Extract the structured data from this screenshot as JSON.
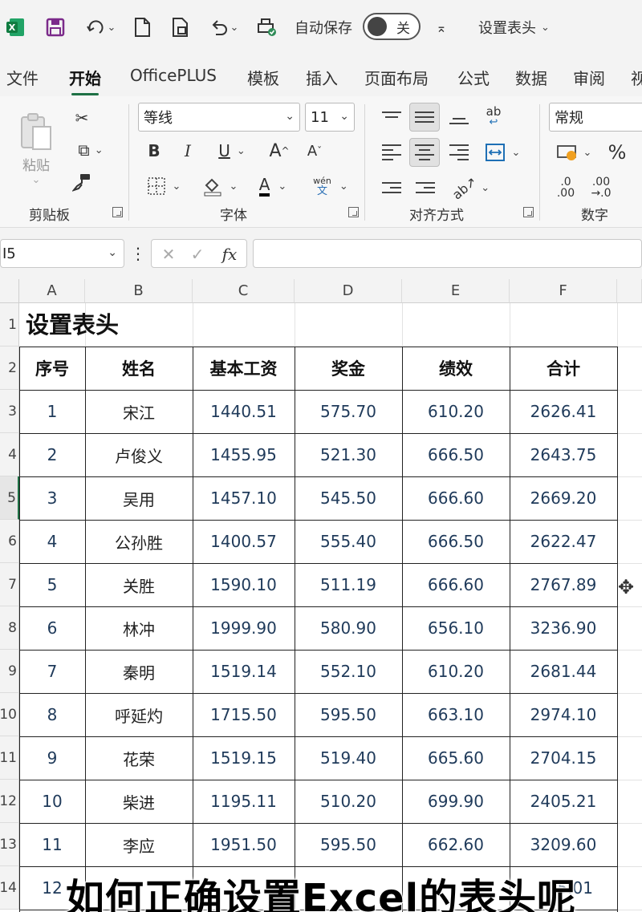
{
  "titlebar": {
    "autosave_label": "自动保存",
    "autosave_state": "关",
    "doc_title": "设置表头",
    "icons": [
      "excel-logo-icon",
      "save-icon",
      "redo-icon",
      "new-file-icon",
      "open-file-icon",
      "undo-icon",
      "print-preview-icon"
    ]
  },
  "tabs": [
    "文件",
    "开始",
    "OfficePLUS",
    "模板",
    "插入",
    "页面布局",
    "公式",
    "数据",
    "审阅",
    "视"
  ],
  "active_tab": "开始",
  "ribbon": {
    "clipboard": {
      "paste": "粘贴",
      "label": "剪贴板"
    },
    "font": {
      "name": "等线",
      "size": "11",
      "bold": "B",
      "italic": "I",
      "underline": "U",
      "grow": "A",
      "shrink": "A",
      "color": "A",
      "phonetic_top": "wén",
      "phonetic_bottom": "文",
      "label": "字体"
    },
    "align": {
      "label": "对齐方式",
      "wrap": "ab"
    },
    "number": {
      "format": "常规",
      "percent": "%",
      "inc_top": ".0",
      "inc_bottom": ".00",
      "dec_top": ".00",
      "dec_bottom": "→.0",
      "label": "数字"
    }
  },
  "formula_bar": {
    "name_box": "I5",
    "fx": "fx",
    "cancel": "✕",
    "enter": "✓",
    "value": ""
  },
  "columns": [
    "A",
    "B",
    "C",
    "D",
    "E",
    "F"
  ],
  "rows": [
    "1",
    "2",
    "3",
    "4",
    "5",
    "6",
    "7",
    "8",
    "9",
    "10",
    "11",
    "12",
    "13",
    "14"
  ],
  "selected_row": "5",
  "sheet": {
    "title": "设置表头",
    "headers": [
      "序号",
      "姓名",
      "基本工资",
      "奖金",
      "绩效",
      "合计"
    ],
    "data": [
      [
        "1",
        "宋江",
        "1440.51",
        "575.70",
        "610.20",
        "2626.41"
      ],
      [
        "2",
        "卢俊义",
        "1455.95",
        "521.30",
        "666.50",
        "2643.75"
      ],
      [
        "3",
        "吴用",
        "1457.10",
        "545.50",
        "666.60",
        "2669.20"
      ],
      [
        "4",
        "公孙胜",
        "1400.57",
        "555.40",
        "666.50",
        "2622.47"
      ],
      [
        "5",
        "关胜",
        "1590.10",
        "511.19",
        "666.60",
        "2767.89"
      ],
      [
        "6",
        "林冲",
        "1999.90",
        "580.90",
        "656.10",
        "3236.90"
      ],
      [
        "7",
        "秦明",
        "1519.14",
        "552.10",
        "610.20",
        "2681.44"
      ],
      [
        "8",
        "呼延灼",
        "1715.50",
        "595.50",
        "663.10",
        "2974.10"
      ],
      [
        "9",
        "花荣",
        "1519.15",
        "519.40",
        "665.60",
        "2704.15"
      ],
      [
        "10",
        "柴进",
        "1195.11",
        "510.20",
        "699.90",
        "2405.21"
      ],
      [
        "11",
        "李应",
        "1951.50",
        "595.50",
        "662.60",
        "3209.60"
      ],
      [
        "12",
        "",
        "",
        "",
        "",
        "5.01"
      ]
    ]
  },
  "caption": "如何正确设置Excel的表头呢"
}
